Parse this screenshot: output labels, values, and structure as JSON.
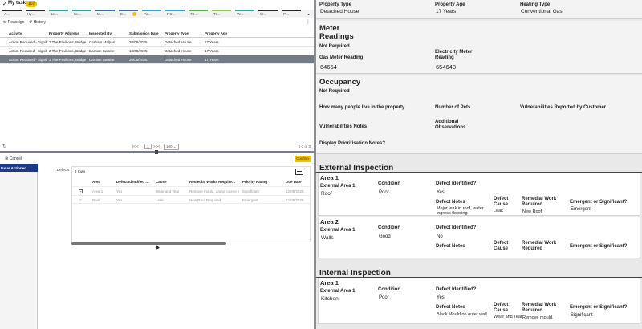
{
  "tasks": {
    "title": "My tasks",
    "count": "107"
  },
  "tabs": [
    {
      "label": "A…",
      "color": "#222222"
    },
    {
      "label": "Hy…",
      "color": "#222222"
    },
    {
      "label": "1c…",
      "color": "#26a69a"
    },
    {
      "label": "5c…",
      "color": "#26a69a"
    },
    {
      "label": "M…",
      "color": "#3b6ea8"
    },
    {
      "label": "E…",
      "color": "#3b6ea8"
    },
    {
      "label": "Pa…",
      "color": "#2aa3d8"
    },
    {
      "label": "RC…",
      "color": "#2aa3d8"
    },
    {
      "label": "78…",
      "color": "#4caf50"
    },
    {
      "label": "Tr…",
      "color": "#8bc34a"
    },
    {
      "label": "Ve…",
      "color": "#26a69a"
    },
    {
      "label": "W…",
      "color": "#222222"
    },
    {
      "label": "P…",
      "color": "#222222"
    }
  ],
  "toolbar": {
    "reassign": "Reassign",
    "history": "History"
  },
  "grid": {
    "columns": [
      "Activity",
      "Property Address",
      "Inspected By",
      "Submission Date",
      "Property Type",
      "Property Age"
    ],
    "rows": [
      [
        "Action Required - Signif…",
        "2 The Pavilions, Bridge …",
        "Graham Malpas",
        "20/08/2025",
        "Detached House",
        "17 Years"
      ],
      [
        "Action Required - Signif…",
        "2 The Pavilions, Bridge …",
        "Damian Swaine",
        "18/08/2025",
        "Detached House",
        "17 Years"
      ],
      [
        "Action Required - Signif…",
        "3 The Pavilions, Bridge …",
        "Damian Swaine",
        "20/08/2025",
        "Detached House",
        "17 Years"
      ]
    ]
  },
  "pager": {
    "page": "1",
    "page_size": "100",
    "count": "1-3 of 3"
  },
  "detail": {
    "cancel": "Cancel",
    "confirm": "Confirm",
    "side_active": "Issue Actioned",
    "defects_label": "Defects",
    "rows_count": "2 rows",
    "columns": [
      "Area",
      "Defect Identified …",
      "Cause",
      "Remedial Works Require…",
      "Priority Rating",
      "Due Date"
    ],
    "rows": [
      {
        "num": "",
        "cells": [
          "Area 1",
          "Yes",
          "Wear and Tear",
          "Remove mould, damp course w…",
          "Significant",
          "22/08/2025"
        ]
      },
      {
        "num": "2",
        "cells": [
          "Roof",
          "Yes",
          "Leak",
          "New Roof Required",
          "Emergent",
          "22/08/2025"
        ]
      }
    ]
  },
  "form": {
    "top": {
      "property_type_label": "Property Type",
      "property_type": "Detached House",
      "property_age_label": "Property Age",
      "property_age": "17 Years",
      "heating_type_label": "Heating Type",
      "heating_type": "Conventional Gas"
    },
    "meter": {
      "title": "Meter Readings",
      "status": "Not Required",
      "gas_label": "Gas Meter Reading",
      "gas": "64654",
      "elec_label": "Electricity Meter Reading",
      "elec": "654648"
    },
    "occupancy": {
      "title": "Occupancy",
      "status": "Not Required",
      "people_label": "How many people live in the property",
      "pets_label": "Number of Pets",
      "vuln_customer_label": "Vulnerabilities Reported by Customer",
      "vuln_notes_label": "Vulnerabilities Notes",
      "add_obs_label": "Additional Observations",
      "prio_notes_label": "Display Prioritisation Notes?"
    },
    "external": {
      "title": "External Inspection",
      "areas": [
        {
          "name": "Area 1",
          "area_label": "External Area 1",
          "area": "Roof",
          "cond_label": "Condition",
          "cond": "Poor",
          "defect_label": "Defect Identified?",
          "defect": "Yes",
          "notes_label": "Defect Notes",
          "notes": "Major leak in roof, water ingress flooding",
          "cause_label": "Defect Cause",
          "cause": "Leak",
          "remedial_label": "Remedial Work Required",
          "remedial": "New Roof",
          "emergent_label": "Emergent or Significant?",
          "emergent": "Emergent"
        },
        {
          "name": "Area 2",
          "area_label": "External Area 1",
          "area": "Walls",
          "cond_label": "Condition",
          "cond": "Good",
          "defect_label": "Defect Identified?",
          "defect": "No",
          "notes_label": "Defect Notes",
          "notes": "",
          "cause_label": "Defect Cause",
          "cause": "",
          "remedial_label": "Remedial Work Required",
          "remedial": "",
          "emergent_label": "Emergent or Significant?",
          "emergent": ""
        }
      ]
    },
    "internal": {
      "title": "Internal Inspection",
      "area": {
        "name": "Area 1",
        "area_label": "External Area 1",
        "area": "Kitchen",
        "cond_label": "Condition",
        "cond": "Poor",
        "defect_label": "Defect Identified?",
        "defect": "Yes",
        "notes_label": "Defect Notes",
        "notes": "Black Mould on outer wall",
        "cause_label": "Defect Cause",
        "cause": "Wear and Tear",
        "remedial_label": "Remedial Work Required",
        "remedial": "Remove mould.",
        "emergent_label": "Emergent or Significant?",
        "emergent": "Significant"
      }
    }
  }
}
